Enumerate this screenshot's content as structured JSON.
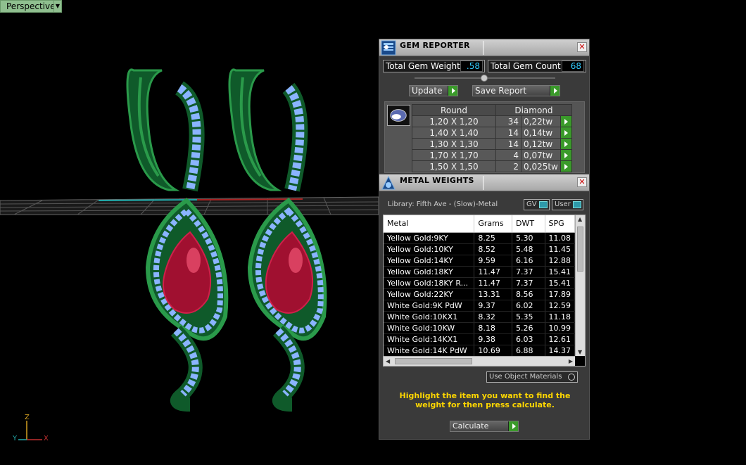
{
  "viewport": {
    "view_label": "Perspective",
    "axis": {
      "z": "Z",
      "y": "Y",
      "x": "X"
    }
  },
  "gem_reporter": {
    "title": "GEM REPORTER",
    "total_weight_label": "Total Gem Weight",
    "total_weight_value": ".58",
    "total_count_label": "Total Gem Count",
    "total_count_value": "68",
    "update_label": "Update",
    "save_report_label": "Save Report",
    "table": {
      "headers": [
        "Round",
        "Diamond"
      ],
      "rows": [
        {
          "size": "1,20 X 1,20",
          "count": "34",
          "weight": "0,22tw"
        },
        {
          "size": "1,40 X 1,40",
          "count": "14",
          "weight": "0,14tw"
        },
        {
          "size": "1,30 X 1,30",
          "count": "14",
          "weight": "0,12tw"
        },
        {
          "size": "1,70 X 1,70",
          "count": "4",
          "weight": "0,07tw"
        },
        {
          "size": "1,50 X 1,50",
          "count": "2",
          "weight": "0,025tw"
        }
      ]
    }
  },
  "metal_weights": {
    "title": "METAL WEIGHTS",
    "library_label": "Library: Fifth Ave - (Slow)-Metal",
    "gv_label": "GV",
    "user_label": "User",
    "columns": [
      "Metal",
      "Grams",
      "DWT",
      "SPG"
    ],
    "rows": [
      [
        "Yellow Gold:9KY",
        "8.25",
        "5.30",
        "11.08"
      ],
      [
        "Yellow Gold:10KY",
        "8.52",
        "5.48",
        "11.45"
      ],
      [
        "Yellow Gold:14KY",
        "9.59",
        "6.16",
        "12.88"
      ],
      [
        "Yellow Gold:18KY",
        "11.47",
        "7.37",
        "15.41"
      ],
      [
        "Yellow Gold:18KY R...",
        "11.47",
        "7.37",
        "15.41"
      ],
      [
        "Yellow Gold:22KY",
        "13.31",
        "8.56",
        "17.89"
      ],
      [
        "White Gold:9K PdW",
        "9.37",
        "6.02",
        "12.59"
      ],
      [
        "White Gold:10KX1",
        "8.32",
        "5.35",
        "11.18"
      ],
      [
        "White Gold:10KW",
        "8.18",
        "5.26",
        "10.99"
      ],
      [
        "White Gold:14KX1",
        "9.38",
        "6.03",
        "12.61"
      ],
      [
        "White Gold:14K PdW",
        "10.69",
        "6.88",
        "14.37"
      ]
    ],
    "use_object_label": "Use Object Materials",
    "hint": "Highlight the item you want to find the weight for then press calculate.",
    "calculate_label": "Calculate"
  }
}
